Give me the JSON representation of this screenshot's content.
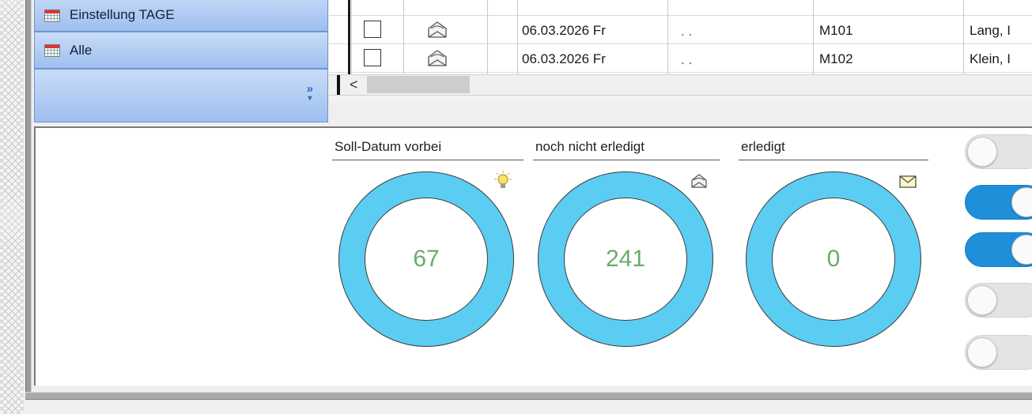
{
  "nav": {
    "items": [
      {
        "label": "Einstellung TAGE",
        "icon": "calendar-icon"
      },
      {
        "label": "Alle",
        "icon": "calendar-icon"
      }
    ],
    "more_icon": "double-chevron-down-icon"
  },
  "grid": {
    "rows": [
      {
        "checked": false,
        "status_icon": "envelope-open-icon",
        "date": "06.03.2026 Fr",
        "time": ". .",
        "code": "M101",
        "name": "Lang, I"
      },
      {
        "checked": false,
        "status_icon": "envelope-open-icon",
        "date": "06.03.2026 Fr",
        "time": ". .",
        "code": "M102",
        "name": "Klein, I"
      }
    ],
    "scroll_left_glyph": "<"
  },
  "dashboard": {
    "kpis": [
      {
        "title": "Soll-Datum vorbei",
        "value": "67",
        "icon": "lightbulb-icon"
      },
      {
        "title": "noch nicht erledigt",
        "value": "241",
        "icon": "envelope-open-icon"
      },
      {
        "title": "erledigt",
        "value": "0",
        "icon": "envelope-closed-icon"
      }
    ],
    "ring_color": "#5bcdf2",
    "value_color": "#6aac6a",
    "toggles": [
      {
        "state": "off"
      },
      {
        "state": "on"
      },
      {
        "state": "on"
      },
      {
        "state": "off"
      },
      {
        "state": "off"
      }
    ],
    "toggle_on_color": "#1e8fd8"
  }
}
